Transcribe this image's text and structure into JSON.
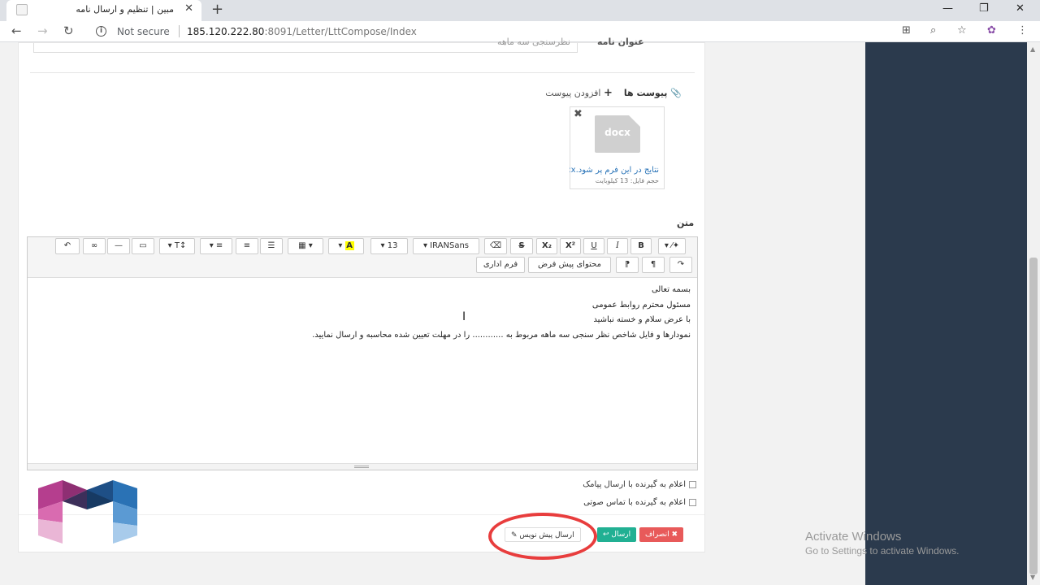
{
  "browser": {
    "tab_title": "مبین | تنظیم و ارسال نامه",
    "security_label": "Not secure",
    "url_host": "185.120.222.80",
    "url_path": ":8091/Letter/LttCompose/Index"
  },
  "form": {
    "subject_label": "عنوان نامه",
    "subject_value": "نظرسنجی سه ماهه"
  },
  "attachments": {
    "label": "پیوست ها",
    "add_label": "افزودن پیوست",
    "files": [
      {
        "ext": "docx",
        "name": "نتایج در این فرم پر شود.docx",
        "size": "حجم فایل: 13 کیلوبایت"
      }
    ]
  },
  "editor": {
    "label": "متن",
    "toolbar": {
      "font_name": "IRANSans",
      "font_size": "13",
      "bold": "B",
      "italic": "I",
      "underline": "U",
      "superscript": "X²",
      "subscript": "X₂",
      "strike": "S",
      "text_size": "T↕",
      "highlight": "A",
      "default_content": "محتوای پیش فرض",
      "admin_form": "فرم اداری"
    },
    "lines": [
      "بسمه تعالی",
      "مسئول محترم روابط عمومی",
      "با عرض سلام و خسته نباشید",
      "نمودارها و فایل شاخص نظر سنجی سه ماهه مربوط به ............ را در مهلت تعیین شده محاسبه و ارسال نمایید."
    ]
  },
  "options": {
    "notify_sms": "اعلام به گیرنده با ارسال پیامک",
    "notify_call": "اعلام به گیرنده با تماس صوتی"
  },
  "actions": {
    "cancel": "✖ انصراف",
    "send": "ارسال",
    "draft": "ارسال پیش نویس"
  },
  "watermark": {
    "line1": "Activate Windows",
    "line2": "Go to Settings to activate Windows."
  },
  "colors": {
    "sidebar": "#2b3a4d",
    "cancel": "#e85a5a",
    "send": "#21b093",
    "highlight_circle": "#e83d3d"
  }
}
